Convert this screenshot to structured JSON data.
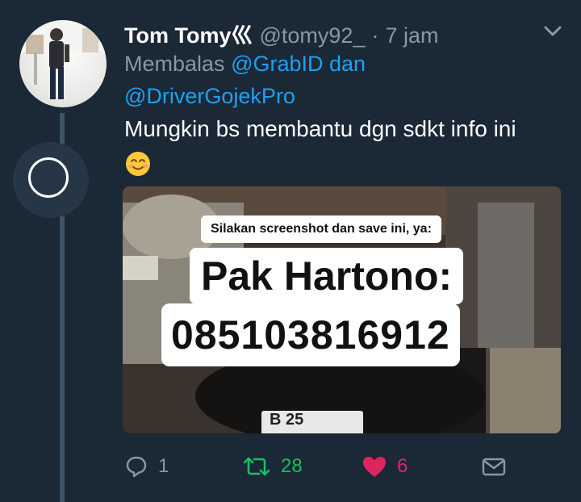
{
  "tweet": {
    "author_name": "Tom Tomy⼮",
    "handle": "@tomy92_",
    "separator": "·",
    "time": "7 jam",
    "reply_prefix": "Membalas",
    "mention_1": "@GrabID",
    "reply_connector": "dan",
    "mention_2": "@DriverGojekPro",
    "text": "Mungkin bs membantu dgn sdkt info ini",
    "emoji": "smiling-face-icon"
  },
  "media": {
    "caption_small": "Silakan screenshot dan save ini, ya:",
    "caption_name": "Pak Hartono:",
    "caption_phone": "085103816912",
    "plate_text": "B 25"
  },
  "actions": {
    "reply_count": "1",
    "retweet_count": "28",
    "like_count": "6"
  },
  "colors": {
    "background": "#1b2836",
    "accent_blue": "#1da1f2",
    "retweet_green": "#17bf63",
    "like_red": "#e0245e",
    "muted_text": "#8899a6"
  }
}
